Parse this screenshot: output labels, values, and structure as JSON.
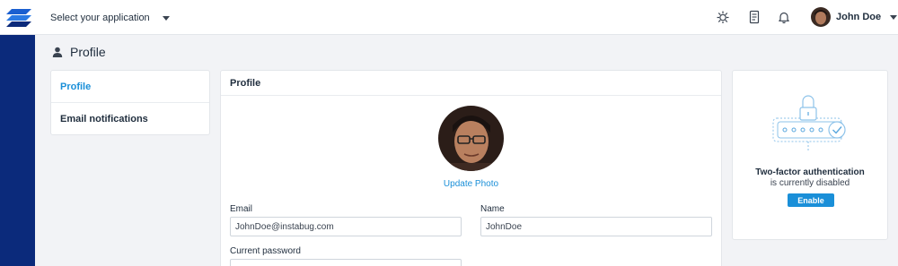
{
  "header": {
    "app_selector_label": "Select your application",
    "user_name": "John Doe",
    "icons": [
      "bug-icon",
      "document-icon",
      "bell-icon"
    ]
  },
  "page": {
    "title": "Profile"
  },
  "nav": {
    "items": [
      {
        "label": "Profile",
        "active": true
      },
      {
        "label": "Email notifications",
        "active": false
      }
    ]
  },
  "profile_card": {
    "heading": "Profile",
    "update_photo": "Update Photo",
    "email": {
      "label": "Email",
      "value": "JohnDoe@instabug.com"
    },
    "name": {
      "label": "Name",
      "value": "JohnDoe"
    },
    "current_password": {
      "label": "Current password",
      "value": ""
    }
  },
  "two_factor": {
    "title": "Two-factor authentication",
    "status": "is currently disabled",
    "button": "Enable"
  },
  "colors": {
    "accent": "#1a8fd8",
    "sidebar": "#0b2a7b",
    "background": "#f2f3f6"
  }
}
